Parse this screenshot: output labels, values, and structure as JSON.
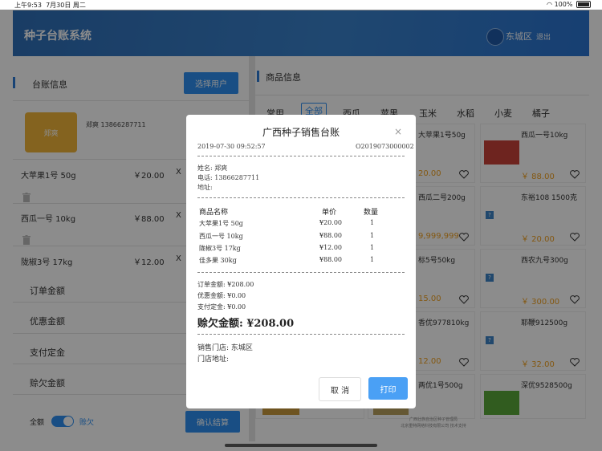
{
  "status": {
    "time": "上午9:53",
    "date": "7月30日 周二",
    "battery": "100%"
  },
  "header": {
    "title": "种子台账系统",
    "district": "东城区",
    "logout": "退出"
  },
  "left": {
    "section_title": "台账信息",
    "select_user": "选择用户",
    "avatar_text": "郑爽",
    "customer_line": "郑爽  13866287711",
    "items": [
      {
        "name": "大苹果1号 50g",
        "price": "￥20.00",
        "x": "X"
      },
      {
        "name": "西瓜一号 10kg",
        "price": "￥88.00",
        "x": "X"
      },
      {
        "name": "陇椒3号 17kg",
        "price": "￥12.00",
        "x": "X"
      }
    ],
    "summary": [
      "订单金额",
      "优惠金额",
      "支付定金",
      "赊欠金额"
    ],
    "summary_cut": "¥",
    "toggle_left": "全额",
    "toggle_right": "赊欠",
    "confirm": "确认结算"
  },
  "right": {
    "section_title": "商品信息",
    "categories": [
      "常用",
      "全部",
      "西瓜",
      "苹果",
      "玉米",
      "水稻",
      "小麦",
      "橘子"
    ],
    "products": [
      {
        "name": "大苹果1号50g",
        "price": "20.00"
      },
      {
        "name": "西瓜一号10kg",
        "price": "￥ 88.00"
      },
      {
        "name": "西瓜二号200g",
        "price": "9,999,999"
      },
      {
        "name": "东裕108 1500克",
        "price": "￥ 20.00"
      },
      {
        "name": "标5号50kg",
        "price": "15.00"
      },
      {
        "name": "西农九号300g",
        "price": "￥ 300.00"
      },
      {
        "name": "香优977810kg",
        "price": "12.00"
      },
      {
        "name": "耶鞭912500g",
        "price": "￥ 32.00"
      },
      {
        "name": "两优1号500g",
        "price": ""
      },
      {
        "name": "深优9528500g",
        "price": ""
      }
    ],
    "qmark": "?"
  },
  "dialog": {
    "title": "广西种子销售台账",
    "close": "×",
    "datetime": "2019-07-30 09:52:57",
    "order_no": "O2019073000002",
    "name": "姓名: 郑爽",
    "phone": "电话: 13866287711",
    "address": "地址:",
    "columns": [
      "商品名称",
      "单价",
      "数量"
    ],
    "rows": [
      [
        "大苹果1号 50g",
        "¥20.00",
        "1"
      ],
      [
        "西瓜一号 10kg",
        "¥88.00",
        "1"
      ],
      [
        "陇椒3号 17kg",
        "¥12.00",
        "1"
      ],
      [
        "佳多果 30kg",
        "¥88.00",
        "1"
      ]
    ],
    "order_amount": "订单金额:  ¥208.00",
    "discount": "优惠金额:  ¥0.00",
    "deposit": "支付定金:  ¥0.00",
    "owed": "赊欠金额:  ¥208.00",
    "store": "销售门店:  东城区",
    "store_addr": "门店地址:",
    "cancel": "取 消",
    "print": "打印"
  },
  "footer": {
    "line1": "广西壮族自治区种子管理局",
    "line2": "北京重特网络科技有限公司 技术支持"
  }
}
